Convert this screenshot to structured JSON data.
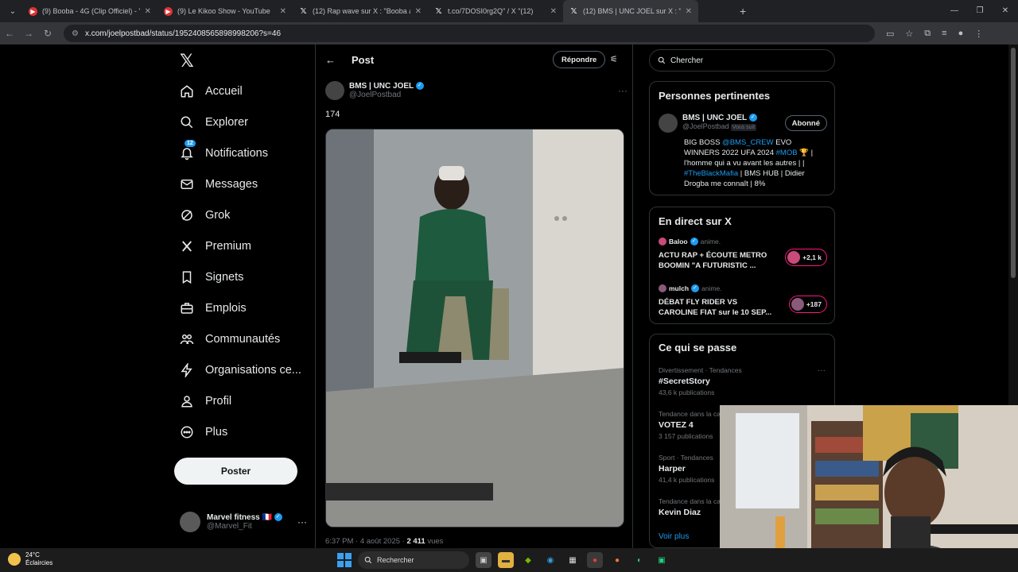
{
  "browser": {
    "tabs": [
      {
        "title": "(9) Booba - 4G (Clip Officiel) - Y",
        "icon": "youtube-icon",
        "active": false
      },
      {
        "title": "(9) Le Kikoo Show - YouTube",
        "icon": "youtube-icon",
        "active": false
      },
      {
        "title": "(12) Rap wave sur X : \"Booba a",
        "icon": "x-icon",
        "active": false
      },
      {
        "title": "t.co/7DOSI0rg2Q\" / X \"(12)",
        "icon": "x-icon",
        "active": false
      },
      {
        "title": "(12) BMS | UNC JOEL sur X : \"1",
        "icon": "x-icon",
        "active": true
      }
    ],
    "new_tab": "+",
    "url": "x.com/joelpostbad/status/1952408565898998206?s=46"
  },
  "x": {
    "nav": [
      {
        "label": "Accueil",
        "icon": "home-icon"
      },
      {
        "label": "Explorer",
        "icon": "search-icon"
      },
      {
        "label": "Notifications",
        "icon": "bell-icon",
        "badge": "12"
      },
      {
        "label": "Messages",
        "icon": "mail-icon"
      },
      {
        "label": "Grok",
        "icon": "grok-icon"
      },
      {
        "label": "Premium",
        "icon": "x-icon"
      },
      {
        "label": "Signets",
        "icon": "bookmark-icon"
      },
      {
        "label": "Emplois",
        "icon": "briefcase-icon"
      },
      {
        "label": "Communautés",
        "icon": "people-icon"
      },
      {
        "label": "Organisations ce...",
        "icon": "lightning-icon"
      },
      {
        "label": "Profil",
        "icon": "user-icon"
      },
      {
        "label": "Plus",
        "icon": "more-circle-icon"
      }
    ],
    "post_button": "Poster",
    "account": {
      "name": "Marvel fitness 🇫🇷",
      "handle": "@Marvel_Fit"
    },
    "post_view": {
      "header_title": "Post",
      "reply_button": "Répondre",
      "author_name": "BMS | UNC JOEL",
      "author_handle": "@JoelPostbad",
      "text": "174",
      "time": "6:37 PM · 4 août 2025 · ",
      "views_count": "2 411",
      "views_label": " vues"
    },
    "search_placeholder": "Chercher",
    "relevant": {
      "title": "Personnes pertinentes",
      "name": "BMS | UNC JOEL",
      "handle": "@JoelPostbad",
      "follows_you": "Vous suit",
      "follow_button": "Abonné",
      "bio_1": "BIG BOSS ",
      "bio_link1": "@BMS_CREW",
      "bio_2": " EVO WINNERS 2022 UFA 2024 ",
      "bio_link2": "#MOB",
      "bio_3": " 🏆 | l'homme qui a vu avant les autres | | ",
      "bio_link3": "#TheBlackMafia",
      "bio_4": " | BMS HUB | Didier Drogba me connaît | 8%"
    },
    "live": {
      "title": "En direct sur X",
      "items": [
        {
          "host": "Baloo",
          "role": "anime.",
          "title": "ACTU RAP + ÉCOUTE METRO BOOMIN \"A FUTURISTIC ...",
          "count": "+2,1 k"
        },
        {
          "host": "mulch",
          "role": "anime.",
          "title": "DÉBAT FLY RIDER VS CAROLINE FIAT sur le 10 SEP...",
          "count": "+187"
        }
      ]
    },
    "trends": {
      "title": "Ce qui se passe",
      "items": [
        {
          "category": "Divertissement · Tendances",
          "name": "#SecretStory",
          "count": "43,6 k publications"
        },
        {
          "category": "Tendance dans la ca",
          "name": "VOTEZ 4",
          "count": "3 157 publications"
        },
        {
          "category": "Sport · Tendances",
          "name": "Harper",
          "count": "41,4 k publications"
        },
        {
          "category": "Tendance dans la ca",
          "name": "Kevin Diaz",
          "count": ""
        }
      ],
      "see_more": "Voir plus"
    }
  },
  "taskbar": {
    "temperature": "24°C",
    "weather": "Éclaircies",
    "search": "Rechercher"
  }
}
